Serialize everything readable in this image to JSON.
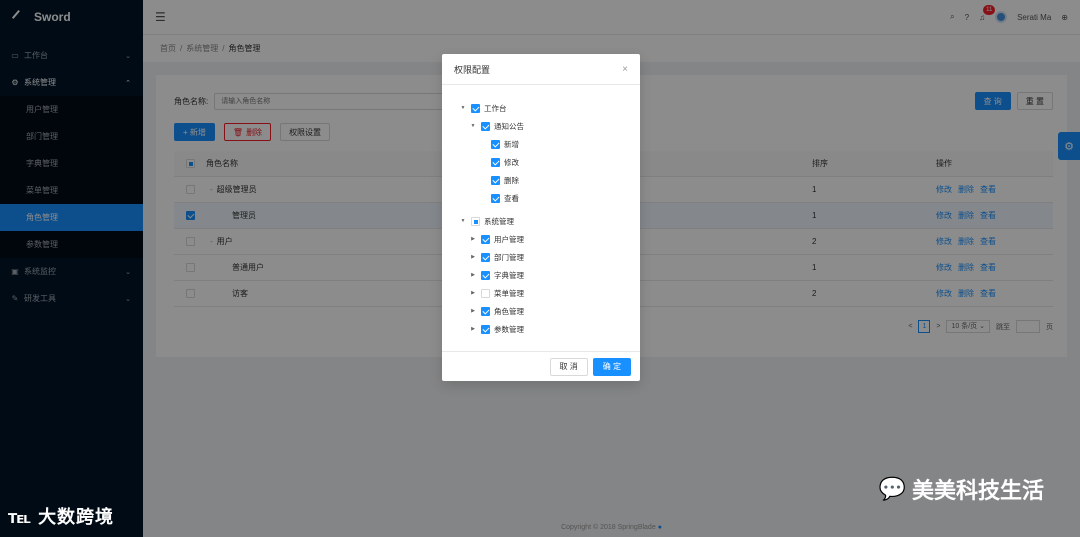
{
  "app": {
    "title": "Sword"
  },
  "sidebar": {
    "items": [
      {
        "label": "工作台",
        "icon": "desktop-icon",
        "caret": "⌄"
      },
      {
        "label": "系统管理",
        "icon": "gear-icon",
        "caret": "⌃"
      },
      {
        "label": "系统监控",
        "icon": "monitor-icon",
        "caret": "⌄"
      },
      {
        "label": "研发工具",
        "icon": "tool-icon",
        "caret": "⌄"
      }
    ],
    "sub_items": [
      "用户管理",
      "部门管理",
      "字典管理",
      "菜单管理",
      "角色管理",
      "参数管理"
    ],
    "active_sub": "角色管理"
  },
  "header": {
    "notification_count": "11",
    "user_name": "Serati Ma"
  },
  "breadcrumb": [
    "首页",
    "系统管理",
    "角色管理"
  ],
  "search": {
    "label": "角色名称:",
    "placeholder": "请输入角色名称",
    "query_label": "查 询",
    "reset_label": "重 置"
  },
  "toolbar": {
    "add_label": "+ 新增",
    "delete_label": "删除",
    "perm_label": "权限设置"
  },
  "table": {
    "headers": {
      "name": "角色名称",
      "sort": "排序",
      "ops": "操作"
    },
    "rows": [
      {
        "name": "超级管理员",
        "sort": "1",
        "checked": false,
        "indent": 1,
        "expander": "-"
      },
      {
        "name": "管理员",
        "sort": "1",
        "checked": true,
        "indent": 2,
        "expander": ""
      },
      {
        "name": "用户",
        "sort": "2",
        "checked": false,
        "indent": 1,
        "expander": "-"
      },
      {
        "name": "普通用户",
        "sort": "1",
        "checked": false,
        "indent": 2,
        "expander": ""
      },
      {
        "name": "访客",
        "sort": "2",
        "checked": false,
        "indent": 2,
        "expander": ""
      }
    ],
    "ops": [
      "修改",
      "删除",
      "查看"
    ]
  },
  "pagination": {
    "prev": "<",
    "page": "1",
    "next": ">",
    "page_size": "10 条/页",
    "jump_label": "跳至",
    "page_suffix": "页"
  },
  "footer": {
    "text": "Copyright © 2018 SpringBlade"
  },
  "watermarks": {
    "left": "大数跨境",
    "right": "美美科技生活"
  },
  "modal": {
    "title": "权限配置",
    "close": "×",
    "cancel_label": "取 消",
    "ok_label": "确 定",
    "tree": [
      {
        "label": "工作台",
        "level": 1,
        "state": "checked",
        "switcher": "▼"
      },
      {
        "label": "通知公告",
        "level": 2,
        "state": "checked",
        "switcher": "▼"
      },
      {
        "label": "新增",
        "level": 3,
        "state": "checked",
        "switcher": ""
      },
      {
        "label": "修改",
        "level": 3,
        "state": "checked",
        "switcher": ""
      },
      {
        "label": "删除",
        "level": 3,
        "state": "checked",
        "switcher": ""
      },
      {
        "label": "查看",
        "level": 3,
        "state": "checked",
        "switcher": ""
      },
      {
        "label": "系统管理",
        "level": 1,
        "state": "half",
        "switcher": "▼"
      },
      {
        "label": "用户管理",
        "level": 2,
        "state": "checked",
        "switcher": "▶"
      },
      {
        "label": "部门管理",
        "level": 2,
        "state": "checked",
        "switcher": "▶"
      },
      {
        "label": "字典管理",
        "level": 2,
        "state": "checked",
        "switcher": "▶"
      },
      {
        "label": "菜单管理",
        "level": 2,
        "state": "unchecked",
        "switcher": "▶"
      },
      {
        "label": "角色管理",
        "level": 2,
        "state": "checked",
        "switcher": "▶"
      },
      {
        "label": "参数管理",
        "level": 2,
        "state": "checked",
        "switcher": "▶"
      }
    ]
  },
  "colors": {
    "primary": "#1890ff",
    "sidebar": "#001529",
    "danger": "#f5222d"
  }
}
